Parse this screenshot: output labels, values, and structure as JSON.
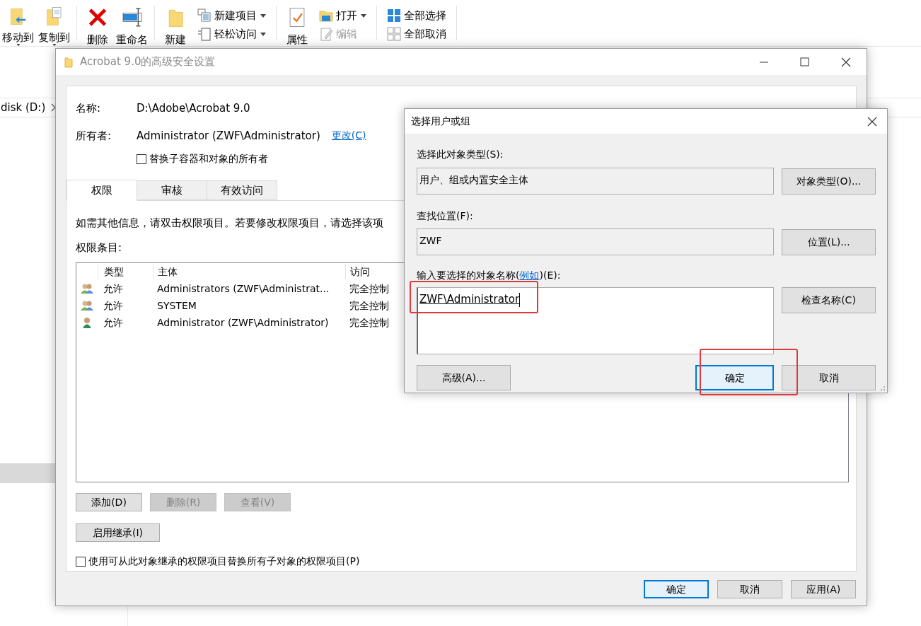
{
  "explorer": {
    "ribbon": [
      {
        "kind": "large",
        "label": "移动到",
        "dropdown": true,
        "disabled": false
      },
      {
        "kind": "large",
        "label": "复制到",
        "dropdown": true,
        "disabled": false
      },
      {
        "kind": "separator"
      },
      {
        "kind": "large",
        "label": "删除",
        "dropdown": false,
        "disabled": false
      },
      {
        "kind": "large",
        "label": "重命名",
        "dropdown": false,
        "disabled": false
      },
      {
        "kind": "separator"
      },
      {
        "kind": "large",
        "label": "新建",
        "dropdown": false,
        "disabled": false
      },
      {
        "kind": "stack",
        "items": [
          {
            "label": "新建项目",
            "dropdown": true,
            "disabled": false
          },
          {
            "label": "轻松访问",
            "dropdown": true,
            "disabled": false
          }
        ]
      },
      {
        "kind": "separator"
      },
      {
        "kind": "large",
        "label": "属性",
        "dropdown": false,
        "disabled": false
      },
      {
        "kind": "stack",
        "items": [
          {
            "label": "打开",
            "dropdown": true,
            "disabled": false
          },
          {
            "label": "编辑",
            "dropdown": false,
            "disabled": true
          }
        ]
      },
      {
        "kind": "separator"
      },
      {
        "kind": "stack",
        "items": [
          {
            "label": "全部选择",
            "dropdown": false,
            "disabled": false
          },
          {
            "label": "全部取消",
            "dropdown": false,
            "disabled": false
          }
        ]
      },
      {
        "kind": "separator"
      }
    ],
    "address": "disk (D:)"
  },
  "security_dialog": {
    "title": "Acrobat 9.0的高级安全设置",
    "name_label": "名称:",
    "name_value": "D:\\Adobe\\Acrobat 9.0",
    "owner_label": "所有者:",
    "owner_value": "Administrator (ZWF\\Administrator)",
    "owner_link": "更改(C)",
    "replace_owner": {
      "label": "替换子容器和对象的所有者",
      "checked": false
    },
    "tabs": [
      {
        "label": "权限",
        "selected": true
      },
      {
        "label": "审核",
        "selected": false
      },
      {
        "label": "有效访问",
        "selected": false
      }
    ],
    "info_text": "如需其他信息，请双击权限项目。若要修改权限项目，请选择该项",
    "entries_label": "权限条目:",
    "columns": [
      "类型",
      "主体",
      "访问"
    ],
    "rows": [
      {
        "kind": "group",
        "type": "允许",
        "principal": "Administrators (ZWF\\Administrat...",
        "access": "完全控制"
      },
      {
        "kind": "group",
        "type": "允许",
        "principal": "SYSTEM",
        "access": "完全控制"
      },
      {
        "kind": "user",
        "type": "允许",
        "principal": "Administrator (ZWF\\Administrator)",
        "access": "完全控制"
      }
    ],
    "list_buttons": [
      {
        "label": "添加(D)",
        "disabled": false
      },
      {
        "label": "删除(R)",
        "disabled": true
      },
      {
        "label": "查看(V)",
        "disabled": true
      }
    ],
    "inherit_button": "启用继承(I)",
    "replace_child": {
      "label": "使用可从此对象继承的权限项目替换所有子对象的权限项目(P)",
      "checked": false
    },
    "footer_buttons": [
      {
        "label": "确定",
        "default": true
      },
      {
        "label": "取消",
        "default": false
      },
      {
        "label": "应用(A)",
        "default": false
      }
    ]
  },
  "select_dialog": {
    "title": "选择用户或组",
    "type_label": "选择此对象类型(S):",
    "type_value": "用户、组或内置安全主体",
    "type_button": "对象类型(O)...",
    "location_label": "查找位置(F):",
    "location_value": "ZWF",
    "location_button": "位置(L)...",
    "name_label_before": "输入要选择的对象名称(",
    "name_label_link": "例如",
    "name_label_after": ")(E):",
    "name_value": "ZWF\\Administrator",
    "name_highlighted": true,
    "check_button": "检查名称(C)",
    "buttons": [
      {
        "label": "高级(A)...",
        "default": false,
        "highlighted": false
      },
      {
        "label": "确定",
        "default": true,
        "highlighted": true
      },
      {
        "label": "取消",
        "default": false,
        "highlighted": false
      }
    ]
  }
}
